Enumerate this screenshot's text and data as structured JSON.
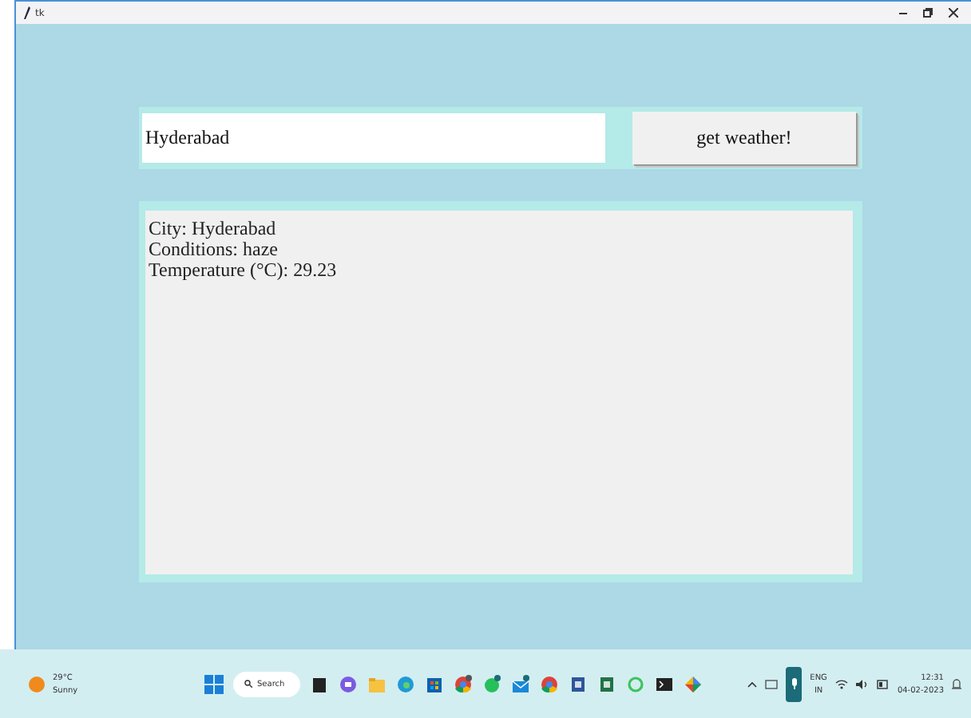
{
  "window": {
    "title": "tk"
  },
  "search_entry": {
    "value": "Hyderabad"
  },
  "fetch_button": {
    "label": "get weather!"
  },
  "output_lines": [
    "City: Hyderabad",
    "Conditions: haze",
    "Temperature (°C): 29.23"
  ],
  "taskbar": {
    "weather": {
      "temperature": "29°C",
      "condition": "Sunny"
    },
    "search": {
      "label": "Search"
    },
    "language": {
      "code": "ENG",
      "region": "IN"
    },
    "clock": {
      "time": "12:31",
      "date": "04-02-2023"
    }
  }
}
